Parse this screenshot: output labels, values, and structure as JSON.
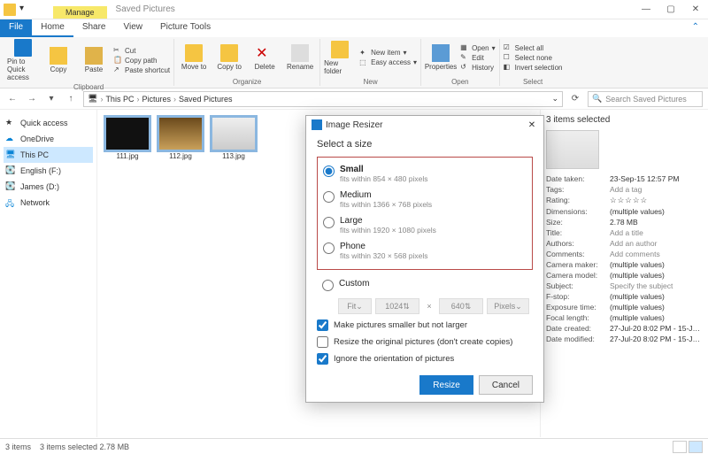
{
  "window": {
    "contextual_tab": "Manage",
    "title": "Saved Pictures"
  },
  "ribbon_tabs": {
    "file": "File",
    "home": "Home",
    "share": "Share",
    "view": "View",
    "picture_tools": "Picture Tools"
  },
  "ribbon": {
    "clipboard": {
      "pin": "Pin to Quick access",
      "copy": "Copy",
      "paste": "Paste",
      "cut": "Cut",
      "copy_path": "Copy path",
      "paste_shortcut": "Paste shortcut",
      "group": "Clipboard"
    },
    "organize": {
      "move_to": "Move to",
      "copy_to": "Copy to",
      "delete": "Delete",
      "rename": "Rename",
      "group": "Organize"
    },
    "new": {
      "new_folder": "New folder",
      "new_item": "New item",
      "easy_access": "Easy access",
      "group": "New"
    },
    "open": {
      "properties": "Properties",
      "open": "Open",
      "edit": "Edit",
      "history": "History",
      "group": "Open"
    },
    "select": {
      "select_all": "Select all",
      "select_none": "Select none",
      "invert": "Invert selection",
      "group": "Select"
    }
  },
  "breadcrumb": {
    "items": [
      "This PC",
      "Pictures",
      "Saved Pictures"
    ]
  },
  "search": {
    "placeholder": "Search Saved Pictures"
  },
  "nav": {
    "items": [
      {
        "label": "Quick access",
        "icon": "star"
      },
      {
        "label": "OneDrive",
        "icon": "cloud"
      },
      {
        "label": "This PC",
        "icon": "pc",
        "selected": true
      },
      {
        "label": "English (F:)",
        "icon": "drive"
      },
      {
        "label": "James (D:)",
        "icon": "drive"
      },
      {
        "label": "Network",
        "icon": "network"
      }
    ]
  },
  "thumbs": [
    {
      "name": "111.jpg"
    },
    {
      "name": "112.jpg"
    },
    {
      "name": "113.jpg"
    }
  ],
  "details": {
    "header": "3 items selected",
    "rows": [
      {
        "k": "Date taken:",
        "v": "23-Sep-15 12:57 PM"
      },
      {
        "k": "Tags:",
        "v": "Add a tag",
        "add": true
      },
      {
        "k": "Rating:",
        "v": "☆☆☆☆☆",
        "stars": true
      },
      {
        "k": "Dimensions:",
        "v": "(multiple values)"
      },
      {
        "k": "Size:",
        "v": "2.78 MB"
      },
      {
        "k": "Title:",
        "v": "Add a title",
        "add": true
      },
      {
        "k": "Authors:",
        "v": "Add an author",
        "add": true
      },
      {
        "k": "Comments:",
        "v": "Add comments",
        "add": true
      },
      {
        "k": "Camera maker:",
        "v": "(multiple values)"
      },
      {
        "k": "Camera model:",
        "v": "(multiple values)"
      },
      {
        "k": "Subject:",
        "v": "Specify the subject",
        "add": true
      },
      {
        "k": "F-stop:",
        "v": "(multiple values)"
      },
      {
        "k": "Exposure time:",
        "v": "(multiple values)"
      },
      {
        "k": "Focal length:",
        "v": "(multiple values)"
      },
      {
        "k": "Date created:",
        "v": "27-Jul-20 8:02 PM - 15-J…"
      },
      {
        "k": "Date modified:",
        "v": "27-Jul-20 8:02 PM - 15-J…"
      }
    ]
  },
  "dialog": {
    "title": "Image Resizer",
    "prompt": "Select a size",
    "options": [
      {
        "name": "Small",
        "sub": "fits within 854 × 480 pixels",
        "selected": true
      },
      {
        "name": "Medium",
        "sub": "fits within 1366 × 768 pixels"
      },
      {
        "name": "Large",
        "sub": "fits within 1920 × 1080 pixels"
      },
      {
        "name": "Phone",
        "sub": "fits within 320 × 568 pixels"
      }
    ],
    "custom": {
      "label": "Custom",
      "fit": "Fit",
      "w": "1024",
      "h": "640",
      "unit": "Pixels",
      "x": "×"
    },
    "checks": [
      {
        "label": "Make pictures smaller but not larger",
        "checked": true
      },
      {
        "label": "Resize the original pictures (don't create copies)",
        "checked": false
      },
      {
        "label": "Ignore the orientation of pictures",
        "checked": true
      }
    ],
    "resize": "Resize",
    "cancel": "Cancel"
  },
  "status": {
    "items": "3 items",
    "selection": "3 items selected 2.78 MB"
  }
}
